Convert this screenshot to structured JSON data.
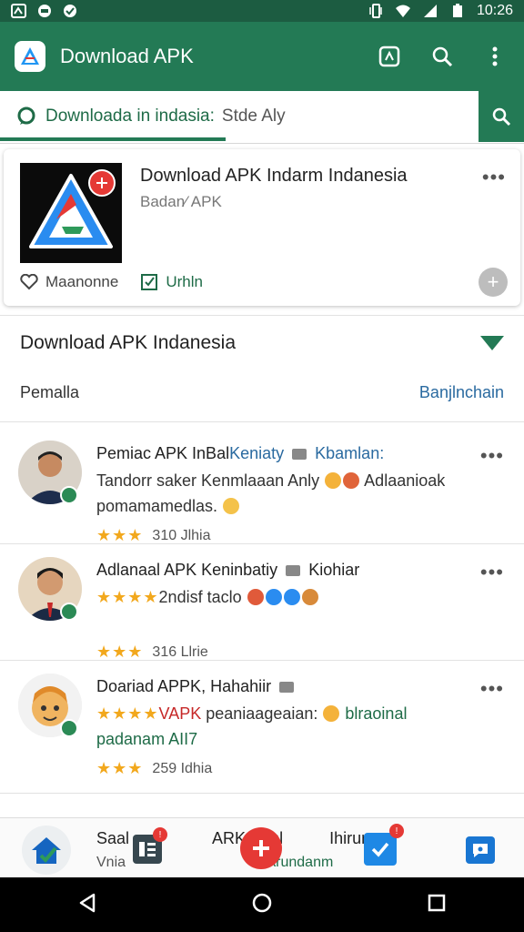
{
  "status_bar": {
    "time": "10:26",
    "icons": [
      "notification-icon",
      "message-icon",
      "check-icon",
      "vibrate-icon",
      "wifi-icon",
      "signal-icon",
      "battery-icon"
    ]
  },
  "app_bar": {
    "title": "Download APK",
    "actions": [
      "screenshot-icon",
      "search-icon",
      "more-vert-icon"
    ]
  },
  "search": {
    "query": "Downloada in indasia:",
    "placeholder": "Stde Aly"
  },
  "featured_app": {
    "title": "Download APK Indarm Indanesia",
    "subtitle": "Badan⁄ APK",
    "wishlist_label": "Maanonne",
    "update_label": "Urhln"
  },
  "section": {
    "title": "Download APK Indanesia",
    "left_label": "Pemalla",
    "right_link": "Banjlnchain"
  },
  "reviews": [
    {
      "title": "Pemiac APK InBal",
      "title_blue": "Keniaty",
      "title_blue2": "Kbamlan:",
      "line2": "Tandorr saker Kenmlaaan Anly",
      "line2_tail": "Adlaanioak",
      "line3": "pomamamedlas.",
      "rating_text": "310 Jlhia",
      "stars": "★★★"
    },
    {
      "title": "Adlanaal APK Keninbatiy",
      "title_tail": "Kiohiar",
      "line2_stars": "★★★★",
      "line2": "2ndisf taclo",
      "line3": "",
      "rating_text": "316 Llrie",
      "stars": "★★★"
    },
    {
      "title": "Doariad APPK, Hahahiir",
      "line2_stars": "★★★★",
      "line2_red": "VAPK",
      "line2": "peaniaageaian:",
      "line2_tail": "blraoinal",
      "line3": "padanam AII7",
      "rating_text": "259 Idhia",
      "stars": "★★★"
    }
  ],
  "bottom_bar": {
    "text": "Saal",
    "text_after": "ARK Kenl",
    "text_tail": "Ihirum",
    "sub": "Vnia",
    "sub_tail": "Arundanm"
  },
  "colors": {
    "primary": "#237a55",
    "primary_dark": "#1c5c41",
    "link": "#2a6aa0",
    "star": "#f2a81d",
    "badge": "#e53935"
  }
}
